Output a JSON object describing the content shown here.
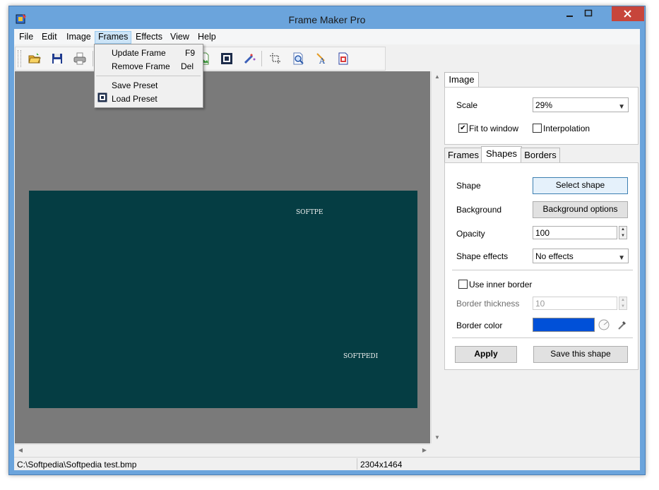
{
  "window": {
    "title": "Frame Maker Pro"
  },
  "menubar": {
    "items": [
      "File",
      "Edit",
      "Image",
      "Frames",
      "Effects",
      "View",
      "Help"
    ]
  },
  "frames_menu": {
    "items": [
      {
        "label": "Update Frame",
        "shortcut": "F9"
      },
      {
        "label": "Remove Frame",
        "shortcut": "Del"
      },
      {
        "label": "Save Preset",
        "shortcut": ""
      },
      {
        "label": "Load Preset",
        "shortcut": ""
      }
    ]
  },
  "toolbar": {
    "icons": [
      "open-folder-icon",
      "save-disk-icon",
      "print-icon",
      "image-icon",
      "frame-icon",
      "magic-wand-icon",
      "crop-icon",
      "zoom-icon",
      "text-icon",
      "document-icon"
    ]
  },
  "canvas": {
    "watermark_top": "SOFTPE",
    "watermark_bottom": "SOFTPEDI"
  },
  "image_panel": {
    "tab": "Image",
    "scale_label": "Scale",
    "scale_value": "29%",
    "fit_to_window_label": "Fit to window",
    "fit_to_window_checked": true,
    "interpolation_label": "Interpolation",
    "interpolation_checked": false
  },
  "tabs": {
    "items": [
      "Frames",
      "Shapes",
      "Borders"
    ],
    "selected": "Shapes"
  },
  "shapes_panel": {
    "shape_label": "Shape",
    "select_shape_button": "Select shape",
    "background_label": "Background",
    "background_options_button": "Background options",
    "opacity_label": "Opacity",
    "opacity_value": "100",
    "shape_effects_label": "Shape effects",
    "shape_effects_value": "No effects",
    "use_inner_border_label": "Use inner border",
    "use_inner_border_checked": false,
    "border_thickness_label": "Border thickness",
    "border_thickness_value": "10",
    "border_color_label": "Border color",
    "border_color": "#0050d8",
    "apply_button": "Apply",
    "save_shape_button": "Save this shape"
  },
  "statusbar": {
    "path": "C:\\Softpedia\\Softpedia test.bmp",
    "dimensions": "2304x1464"
  },
  "colors": {
    "accent": "#6ba4dc",
    "teal_frame": "#053d43",
    "canvas_bg": "#7a7a7a"
  }
}
